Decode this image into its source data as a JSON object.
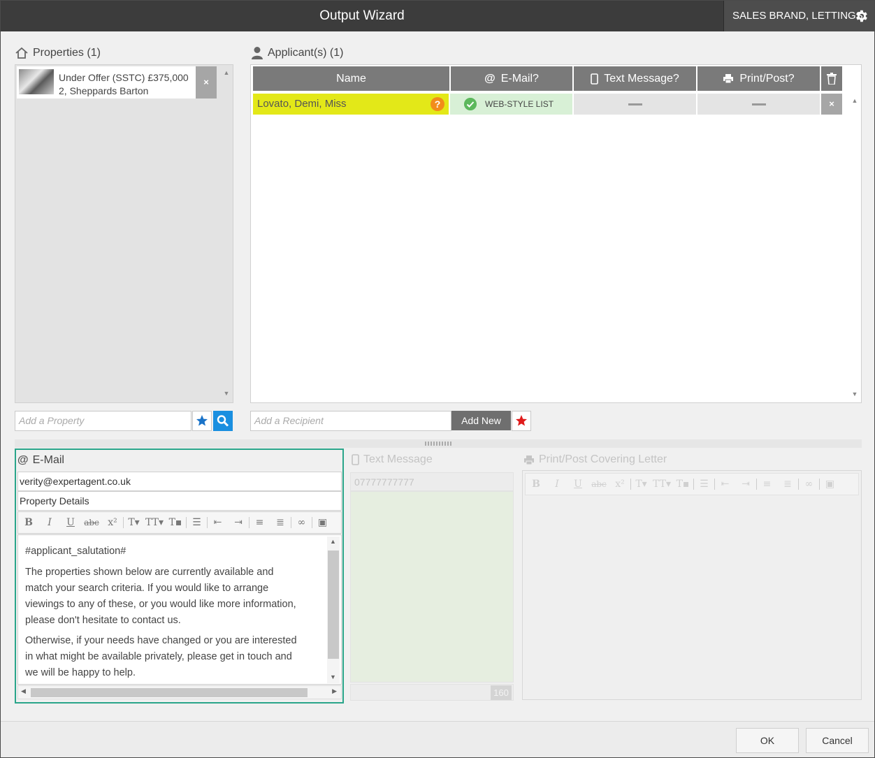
{
  "window": {
    "title": "Output Wizard",
    "brand": "SALES BRAND, LETTINGS"
  },
  "properties": {
    "label": "Properties (1)",
    "items": [
      {
        "line1": "Under Offer (SSTC) £375,000",
        "line2": "2, Sheppards Barton",
        "remove": "×"
      }
    ],
    "add_placeholder": "Add a Property"
  },
  "applicants": {
    "label": "Applicant(s) (1)",
    "columns": {
      "name": "Name",
      "email": "E-Mail?",
      "sms": "Text Message?",
      "print": "Print/Post?"
    },
    "rows": [
      {
        "name": "Lovato, Demi, Miss",
        "badge": "?",
        "email_status": "WEB-STYLE LIST",
        "remove": "×"
      }
    ],
    "add_placeholder": "Add a Recipient",
    "add_new": "Add New"
  },
  "email": {
    "label": "E-Mail",
    "to": "verity@expertagent.co.uk",
    "subject": "Property Details",
    "body": [
      "#applicant_salutation#",
      "The properties shown below are currently available and match your search criteria. If you would like to arrange viewings to any of these, or you would like more information, please don't hesitate to contact us.",
      "Otherwise, if your needs have changed or you are interested in what might be available privately, please get in touch and we will be happy to help."
    ]
  },
  "sms": {
    "label": "Text Message",
    "number": "07777777777",
    "count": "160"
  },
  "print": {
    "label": "Print/Post Covering Letter"
  },
  "footer": {
    "ok": "OK",
    "cancel": "Cancel"
  },
  "colors": {
    "accent_green": "#2aa58a",
    "highlight_yellow": "#e3e818",
    "email_ok_bg": "#d8f0d6",
    "search_blue": "#1a8fe0",
    "badge_orange": "#f28c1a"
  }
}
